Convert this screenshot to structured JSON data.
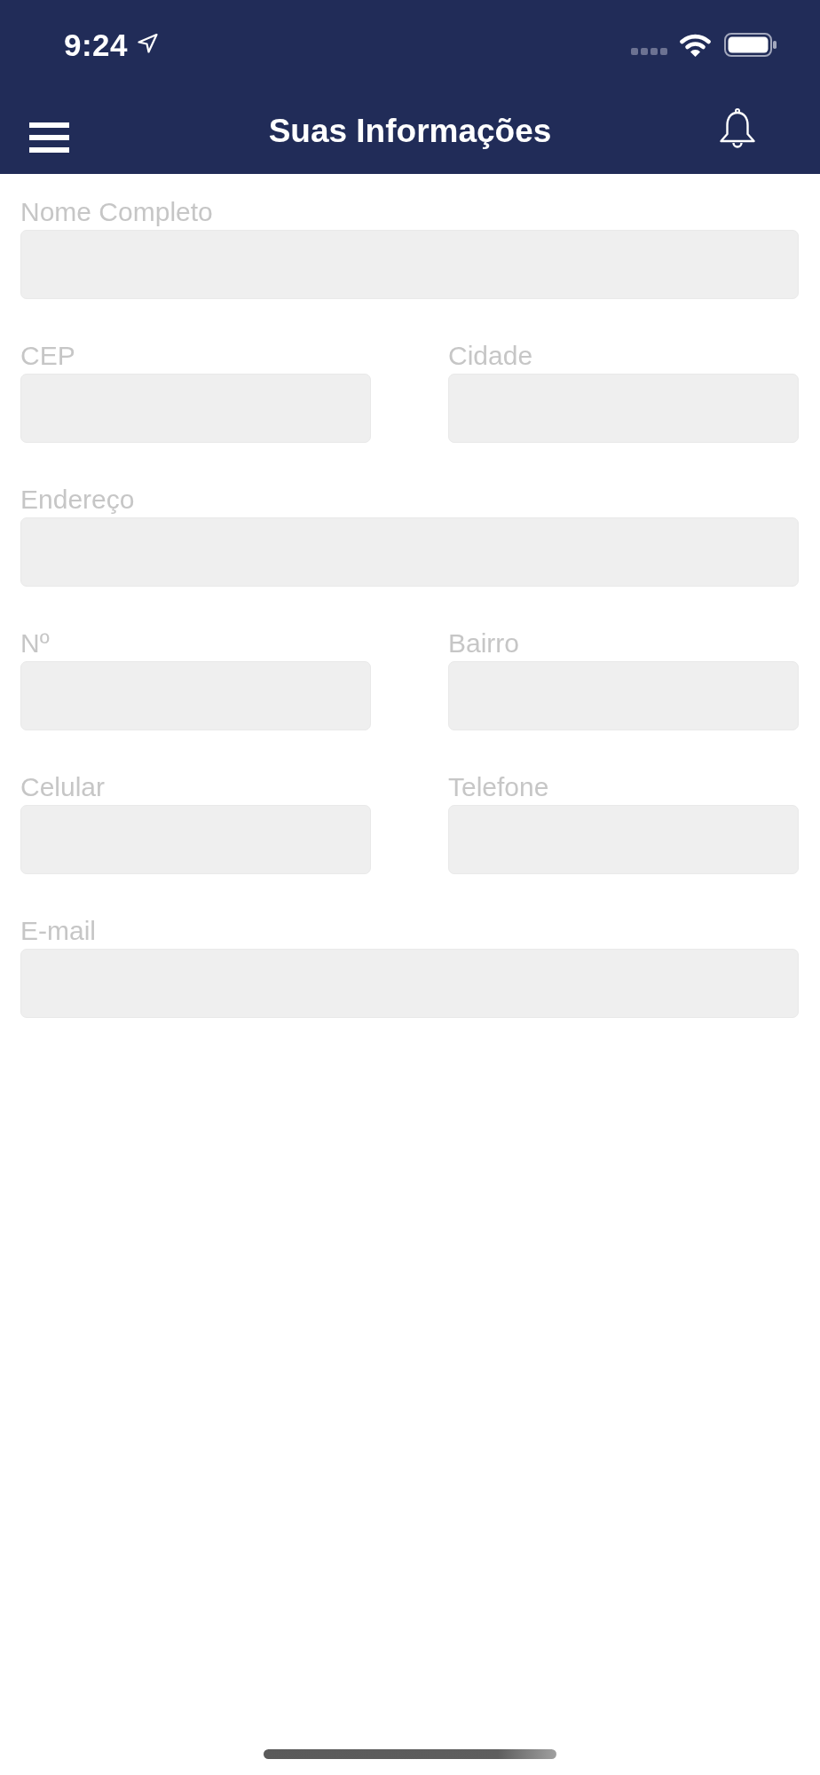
{
  "status_bar": {
    "time": "9:24"
  },
  "nav_bar": {
    "title": "Suas Informações"
  },
  "form": {
    "rows": [
      {
        "fields": [
          {
            "label": "Nome Completo"
          }
        ]
      },
      {
        "fields": [
          {
            "label": "CEP"
          },
          {
            "label": "Cidade"
          }
        ]
      },
      {
        "fields": [
          {
            "label": "Endereço"
          }
        ]
      },
      {
        "fields": [
          {
            "label": "Nº"
          },
          {
            "label": "Bairro"
          }
        ]
      },
      {
        "fields": [
          {
            "label": "Celular"
          },
          {
            "label": "Telefone"
          }
        ]
      },
      {
        "fields": [
          {
            "label": "E-mail"
          }
        ]
      }
    ]
  }
}
